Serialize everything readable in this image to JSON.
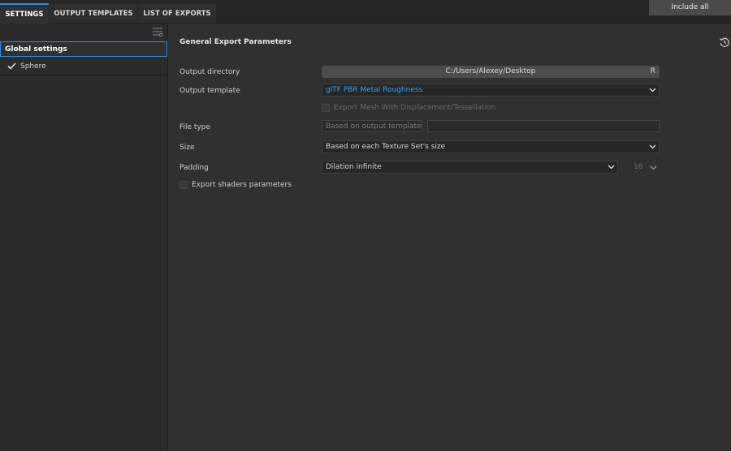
{
  "tabs": [
    {
      "label": "SETTINGS"
    },
    {
      "label": "OUTPUT TEMPLATES"
    },
    {
      "label": "LIST OF EXPORTS"
    }
  ],
  "include_all": "Include all",
  "sidebar": {
    "global_settings": "Global settings",
    "items": [
      {
        "label": "Sphere",
        "checked": true
      }
    ]
  },
  "main": {
    "section_title": "General Export Parameters",
    "output_directory": {
      "label": "Output directory",
      "value": "C:/Users/Alexey/Desktop",
      "button": "R"
    },
    "output_template": {
      "label": "Output template",
      "value": "glTF PBR Metal Roughness"
    },
    "export_mesh": {
      "label": "Export Mesh With Displacement/Tessellation",
      "checked": false,
      "disabled": true
    },
    "file_type": {
      "label": "File type",
      "placeholder": "Based on output template",
      "second_value": ""
    },
    "size": {
      "label": "Size",
      "value": "Based on each Texture Set's size"
    },
    "padding": {
      "label": "Padding",
      "value": "Dilation infinite",
      "number": "16"
    },
    "export_shaders": {
      "label": "Export shaders parameters",
      "checked": false
    }
  },
  "colors": {
    "accent": "#2b8ce0",
    "link": "#3c9ff0",
    "background": "#303030"
  },
  "icons": [
    "filter-icon",
    "check-icon",
    "reset-icon",
    "chevron-down-icon"
  ]
}
